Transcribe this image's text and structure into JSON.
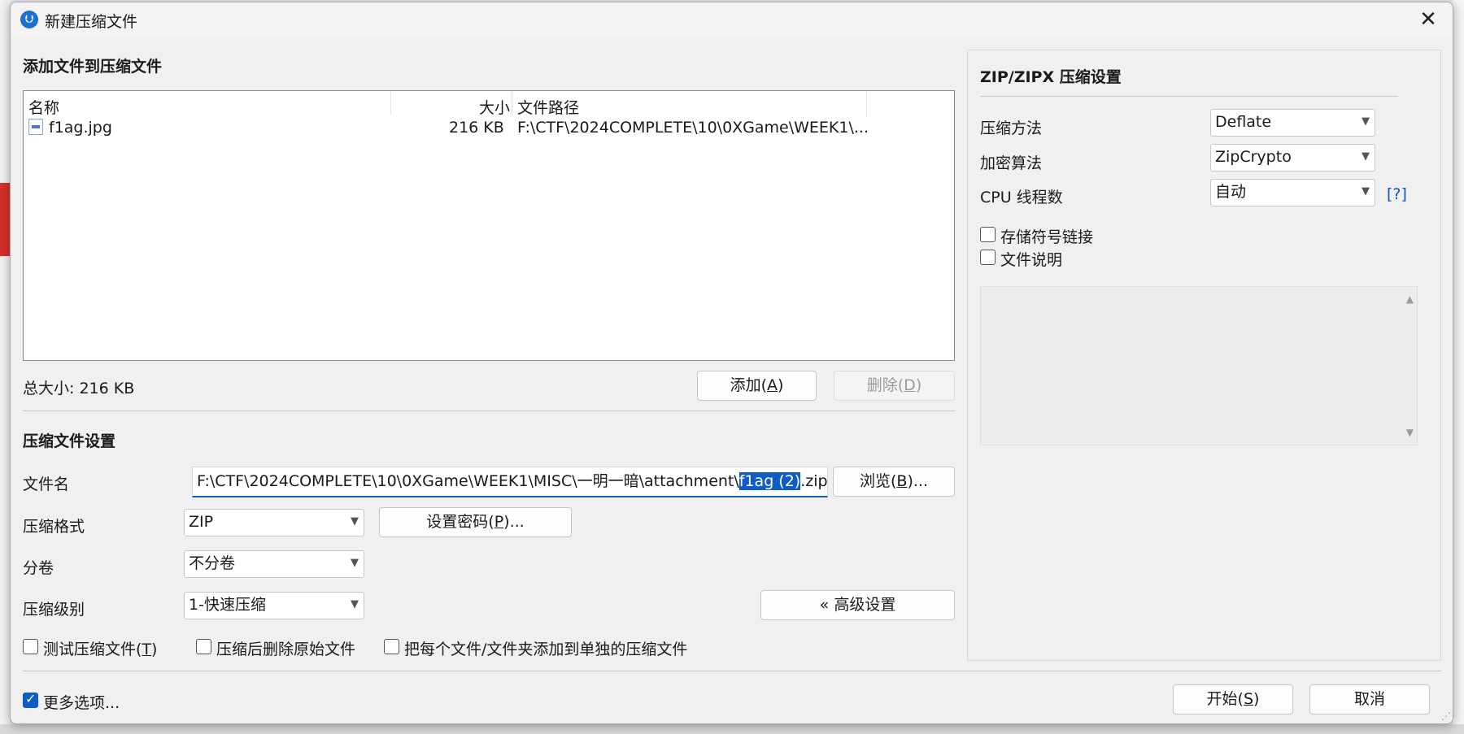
{
  "window": {
    "title": "新建压缩文件",
    "close_glyph": "✕"
  },
  "add_section": {
    "heading": "添加文件到压缩文件",
    "columns": {
      "name": "名称",
      "size": "大小",
      "path": "文件路径"
    },
    "files": [
      {
        "name": "f1ag.jpg",
        "size": "216 KB",
        "path": "F:\\CTF\\2024COMPLETE\\10\\0XGame\\WEEK1\\..."
      }
    ],
    "total_size": "总大小: 216 KB",
    "add_button": {
      "text": "添加(",
      "key": "A",
      "end": ")"
    },
    "delete_button": {
      "text": "删除(",
      "key": "D",
      "end": ")"
    }
  },
  "archive_settings": {
    "heading": "压缩文件设置",
    "filename_label": "文件名",
    "filename_prefix": "F:\\CTF\\2024COMPLETE\\10\\0XGame\\WEEK1\\MISC\\一明一暗\\attachment\\",
    "filename_selected": "f1ag (2)",
    "filename_suffix": ".zip",
    "browse_button": {
      "text": "浏览(",
      "key": "B",
      "end": ")..."
    },
    "format_label": "压缩格式",
    "format_value": "ZIP",
    "password_button": {
      "text": "设置密码(",
      "key": "P",
      "end": ")..."
    },
    "split_label": "分卷",
    "split_value": "不分卷",
    "level_label": "压缩级别",
    "level_value": "1-快速压缩",
    "advanced_button": "« 高级设置",
    "options": [
      {
        "text": "测试压缩文件(",
        "key": "T",
        "end": ")",
        "checked": false
      },
      {
        "text": "压缩后删除原始文件",
        "checked": false
      },
      {
        "text": "把每个文件/文件夹添加到单独的压缩文件",
        "checked": false
      }
    ]
  },
  "zip_settings": {
    "heading": "ZIP/ZIPX 压缩设置",
    "method_label": "压缩方法",
    "method_value": "Deflate",
    "encryption_label": "加密算法",
    "encryption_value": "ZipCrypto",
    "threads_label": "CPU 线程数",
    "threads_value": "自动",
    "help_link": "[?]",
    "store_symlinks": {
      "label": "存储符号链接",
      "checked": false
    },
    "file_comment": {
      "label": "文件说明",
      "checked": false
    }
  },
  "footer": {
    "more_options": {
      "label": "更多选项...",
      "checked": true
    },
    "start_button": {
      "text": "开始(",
      "key": "S",
      "end": ")"
    },
    "cancel_button": "取消"
  },
  "icons": {
    "app": "archiver-app-icon",
    "file": "image-file-icon",
    "chevron": "chevron-down-icon"
  },
  "colors": {
    "accent": "#0f5cc5",
    "link": "#0b56c4"
  }
}
